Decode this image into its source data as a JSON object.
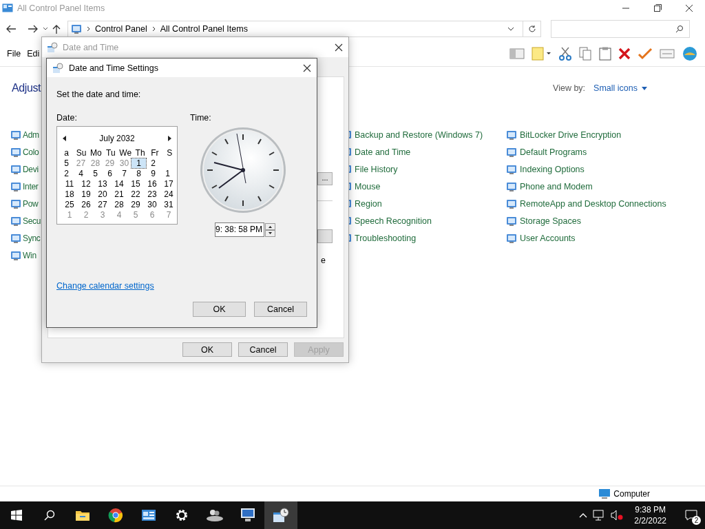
{
  "explorer": {
    "title": "All Control Panel Items",
    "breadcrumb": [
      "Control Panel",
      "All Control Panel Items"
    ],
    "menu": [
      "File",
      "Edi"
    ],
    "heading": "Adjust",
    "view_by_label": "View by:",
    "view_by_value": "Small icons",
    "columns": [
      [
        "Adm",
        "Colo",
        "Devi",
        "Inter",
        "Pow",
        "Secu",
        "Sync",
        "Win"
      ],
      [],
      [
        "Backup and Restore (Windows 7)",
        "Date and Time",
        "File History",
        "Mouse",
        "Region",
        "Speech Recognition",
        "Troubleshooting"
      ],
      [
        "BitLocker Drive Encryption",
        "Default Programs",
        "Indexing Options",
        "Phone and Modem",
        "RemoteApp and Desktop Connections",
        "Storage Spaces",
        "User Accounts"
      ]
    ],
    "status": "Computer"
  },
  "date_time_dialog": {
    "title": "Date and Time",
    "partial_button": "...",
    "partial_text": "e",
    "buttons": [
      {
        "label": "OK",
        "disabled": false
      },
      {
        "label": "Cancel",
        "disabled": false
      },
      {
        "label": "Apply",
        "disabled": true
      }
    ]
  },
  "settings_dialog": {
    "title": "Date and Time Settings",
    "prompt": "Set the date and time:",
    "date_label": "Date:",
    "time_label": "Time:",
    "calendar": {
      "month": "July 2032",
      "rows": [
        {
          "kind": "header",
          "cells": [
            {
              "day": "a",
              "muted": false,
              "selected": false
            },
            {
              "day": "Su",
              "muted": false,
              "selected": false
            },
            {
              "day": "Mo",
              "muted": false,
              "selected": false
            },
            {
              "day": "Tu",
              "muted": false,
              "selected": false
            },
            {
              "day": "We",
              "muted": false,
              "selected": false
            },
            {
              "day": "Th",
              "muted": false,
              "selected": false
            },
            {
              "day": "Fr",
              "muted": false,
              "selected": false
            },
            {
              "day": "S",
              "muted": false,
              "selected": false
            }
          ]
        },
        {
          "kind": "glitch",
          "cells": [
            {
              "day": "5",
              "muted": false,
              "selected": false
            },
            {
              "day": "27",
              "muted": true,
              "selected": false
            },
            {
              "day": "28",
              "muted": true,
              "selected": false
            },
            {
              "day": "29",
              "muted": true,
              "selected": false
            },
            {
              "day": "30",
              "muted": true,
              "selected": false
            },
            {
              "day": "1",
              "muted": false,
              "selected": true
            },
            {
              "day": "2",
              "muted": false,
              "selected": false
            }
          ]
        },
        {
          "kind": "glitch",
          "cells": [
            {
              "day": "2",
              "muted": false,
              "selected": false
            },
            {
              "day": "4",
              "muted": false,
              "selected": false
            },
            {
              "day": "5",
              "muted": false,
              "selected": false
            },
            {
              "day": "6",
              "muted": false,
              "selected": false
            },
            {
              "day": "7",
              "muted": false,
              "selected": false
            },
            {
              "day": "8",
              "muted": false,
              "selected": false
            },
            {
              "day": "9",
              "muted": false,
              "selected": false
            },
            {
              "day": "1",
              "muted": false,
              "selected": false
            }
          ]
        },
        {
          "kind": "week",
          "cells": [
            {
              "day": "11",
              "muted": false,
              "selected": false
            },
            {
              "day": "12",
              "muted": false,
              "selected": false
            },
            {
              "day": "13",
              "muted": false,
              "selected": false
            },
            {
              "day": "14",
              "muted": false,
              "selected": false
            },
            {
              "day": "15",
              "muted": false,
              "selected": false
            },
            {
              "day": "16",
              "muted": false,
              "selected": false
            },
            {
              "day": "17",
              "muted": false,
              "selected": false
            }
          ]
        },
        {
          "kind": "week",
          "cells": [
            {
              "day": "18",
              "muted": false,
              "selected": false
            },
            {
              "day": "19",
              "muted": false,
              "selected": false
            },
            {
              "day": "20",
              "muted": false,
              "selected": false
            },
            {
              "day": "21",
              "muted": false,
              "selected": false
            },
            {
              "day": "22",
              "muted": false,
              "selected": false
            },
            {
              "day": "23",
              "muted": false,
              "selected": false
            },
            {
              "day": "24",
              "muted": false,
              "selected": false
            }
          ]
        },
        {
          "kind": "week",
          "cells": [
            {
              "day": "25",
              "muted": false,
              "selected": false
            },
            {
              "day": "26",
              "muted": false,
              "selected": false
            },
            {
              "day": "27",
              "muted": false,
              "selected": false
            },
            {
              "day": "28",
              "muted": false,
              "selected": false
            },
            {
              "day": "29",
              "muted": false,
              "selected": false
            },
            {
              "day": "30",
              "muted": false,
              "selected": false
            },
            {
              "day": "31",
              "muted": false,
              "selected": false
            }
          ]
        },
        {
          "kind": "week",
          "cells": [
            {
              "day": "1",
              "muted": true,
              "selected": false
            },
            {
              "day": "2",
              "muted": true,
              "selected": false
            },
            {
              "day": "3",
              "muted": true,
              "selected": false
            },
            {
              "day": "4",
              "muted": true,
              "selected": false
            },
            {
              "day": "5",
              "muted": true,
              "selected": false
            },
            {
              "day": "6",
              "muted": true,
              "selected": false
            },
            {
              "day": "7",
              "muted": true,
              "selected": false
            }
          ]
        }
      ]
    },
    "time": "9: 38: 58 PM",
    "link": "Change calendar settings",
    "buttons": [
      "OK",
      "Cancel"
    ]
  },
  "taskbar": {
    "apps": [
      {
        "kind": "folder",
        "active": false
      },
      {
        "kind": "browser",
        "active": false
      },
      {
        "kind": "panel",
        "active": false
      },
      {
        "kind": "gear",
        "active": false
      },
      {
        "kind": "people",
        "active": false
      },
      {
        "kind": "monitor",
        "active": false
      },
      {
        "kind": "calendar",
        "active": true
      }
    ],
    "time": "9:38 PM",
    "date": "2/2/2022",
    "notifications": "2"
  }
}
